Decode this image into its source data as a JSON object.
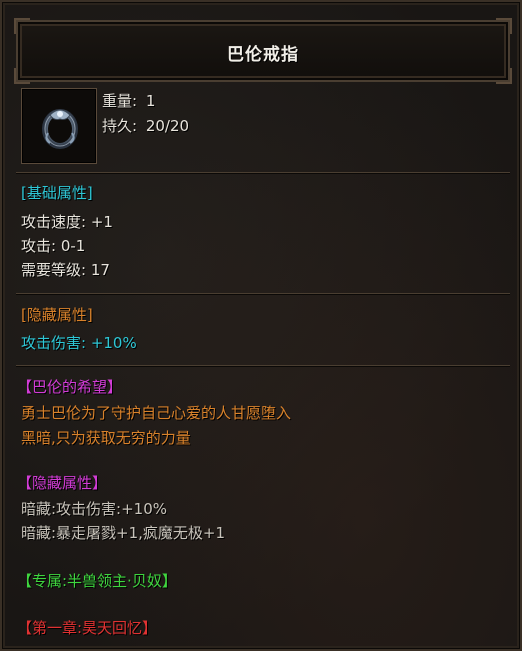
{
  "item": {
    "name": "巴伦戒指",
    "icon": "ring-icon",
    "weight_label": "重量:",
    "weight_value": "1",
    "durability_label": "持久:",
    "durability_value": "20/20"
  },
  "base_attributes": {
    "header": "[基础属性]",
    "lines": [
      "攻击速度: +1",
      "攻击: 0-1",
      "需要等级: 17"
    ]
  },
  "hidden_attributes": {
    "header": "[隐藏属性]",
    "lines": [
      "攻击伤害: +10%"
    ]
  },
  "lore": {
    "header": "【巴伦的希望】",
    "lines": [
      "勇士巴伦为了守护自己心爱的人甘愿堕入",
      "黑暗,只为获取无穷的力量"
    ]
  },
  "hidden_attributes_2": {
    "header": "【隐藏属性】",
    "lines": [
      "暗藏:攻击伤害:+10%",
      "暗藏:暴走屠戮+1,疯魔无极+1"
    ]
  },
  "exclusive": {
    "text": "【专属:半兽领主·贝奴】"
  },
  "chapter": {
    "text": "【第一章:昊天回忆】"
  },
  "colors": {
    "section_header": "#2ec7d6",
    "hidden_header": "#d9822b",
    "lore_header": "#d23cd6",
    "lore_text": "#d9822b",
    "exclusive": "#3fd63f",
    "chapter": "#e03232"
  }
}
